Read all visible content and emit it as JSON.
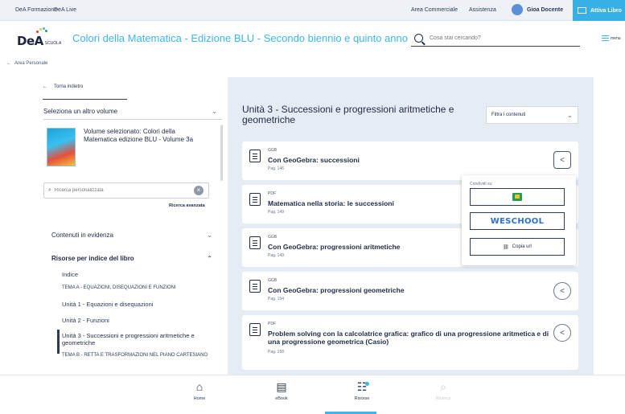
{
  "topbar": {
    "left_links": [
      "DeA Formazione",
      "DeA Live"
    ],
    "right_links": [
      "Area Commerciale",
      "Assistenza"
    ],
    "user_name": "Gioa Docente",
    "attiva_label": "Attiva Libro"
  },
  "header": {
    "logo_text": "DeA",
    "logo_sub": "SCUOLA",
    "book_title": "Colori della Matematica - Edizione BLU - Secondo biennio e quinto anno",
    "search_placeholder": "Cosa stai cercando?",
    "menu_label": "menu"
  },
  "breadcrumb": {
    "label": "Area Personale"
  },
  "sidebar": {
    "back_label": "Torna indietro",
    "select_volume_label": "Seleziona un altro volume",
    "selected_volume_text": "Volume selezionato: Colori della Matematica edizione BLU - Volume 3a",
    "search_placeholder": "Ricerca personalizzata",
    "advanced_search": "Ricerca avanzata",
    "section_highlights": "Contenuti in evidenza",
    "section_index": "Risorse per indice del libro",
    "index_items": [
      "Indice",
      "TEMA A - EQUAZIONI, DISEQUAZIONI E FUNZIONI",
      "Unità 1 - Equazioni e disequazioni",
      "Unità 2 - Funzioni",
      "Unità 3 - Successioni e progressioni aritmetiche e geometriche",
      "TEMA B - RETTA E TRASFORMAZIONI NEL PIANO CARTESIANO"
    ]
  },
  "main": {
    "unit_title": "Unità 3 - Successioni e progressioni aritmetiche e geometriche",
    "filter_label": "Filtra i contenuti",
    "resources": [
      {
        "type": "GGB",
        "title": "Con GeoGebra: successioni",
        "page": "Pag. 146"
      },
      {
        "type": "PDF",
        "title": "Matematica nella storia: le successioni",
        "page": "Pag. 149"
      },
      {
        "type": "GGB",
        "title": "Con GeoGebra: progressioni aritmetiche",
        "page": "Pag. 149"
      },
      {
        "type": "GGB",
        "title": "Con GeoGebra: progressioni geometriche",
        "page": "Pag. 154"
      },
      {
        "type": "PDF",
        "title": "Problem solving con la calcolatrice grafica: grafico di una progressione aritmetica e di una progressione geometrica (Casio)",
        "page": "Pag. 158"
      }
    ],
    "share_popup": {
      "label": "Condividi su:",
      "weschool": "WESCHOOL",
      "copy_url": "Copia url"
    }
  },
  "bottom_nav": [
    {
      "label": "Home",
      "icon": "home-icon"
    },
    {
      "label": "eBook",
      "icon": "ebook-icon"
    },
    {
      "label": "Risorse",
      "icon": "resources-icon"
    },
    {
      "label": "Ricerca",
      "icon": "search-icon"
    }
  ],
  "colors": {
    "accent": "#3fb5e8",
    "dark": "#1f2a44",
    "panel": "#e5ecf4"
  }
}
